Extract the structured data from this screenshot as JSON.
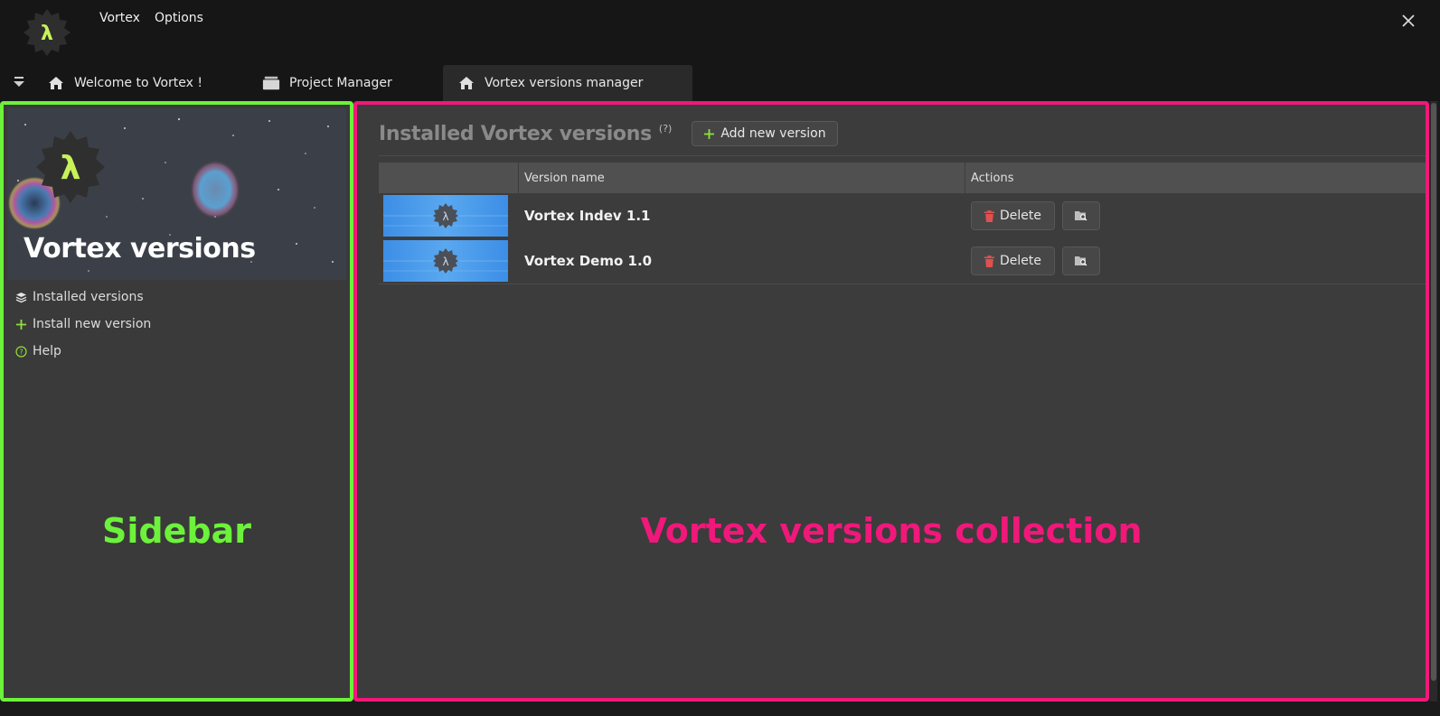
{
  "menu": {
    "items": [
      "Vortex",
      "Options"
    ]
  },
  "app_logo_glyph": "λ",
  "tabs": [
    {
      "label": "Welcome to Vortex !",
      "icon": "home-icon"
    },
    {
      "label": "Project Manager",
      "icon": "stack-icon"
    },
    {
      "label": "Vortex versions manager",
      "icon": "home-icon",
      "active": true
    }
  ],
  "sidebar": {
    "banner_title": "Vortex versions",
    "items": [
      {
        "label": "Installed versions",
        "icon": "layers-icon"
      },
      {
        "label": "Install new version",
        "icon": "plus-icon"
      },
      {
        "label": "Help",
        "icon": "help-circle-icon"
      }
    ],
    "caption": "Sidebar"
  },
  "main": {
    "title": "Installed Vortex versions",
    "help_mark": "(?)",
    "add_button_label": "Add new version",
    "columns": [
      "",
      "Version name",
      "Actions"
    ],
    "rows": [
      {
        "name": "Vortex Indev 1.1",
        "delete_label": "Delete"
      },
      {
        "name": "Vortex Demo 1.0",
        "delete_label": "Delete"
      }
    ],
    "caption": "Vortex versions collection"
  },
  "colors": {
    "accent_green": "#6cf23a",
    "accent_pink": "#f0187a",
    "lambda_green": "#c7f25a",
    "delete_red": "#e05050"
  }
}
